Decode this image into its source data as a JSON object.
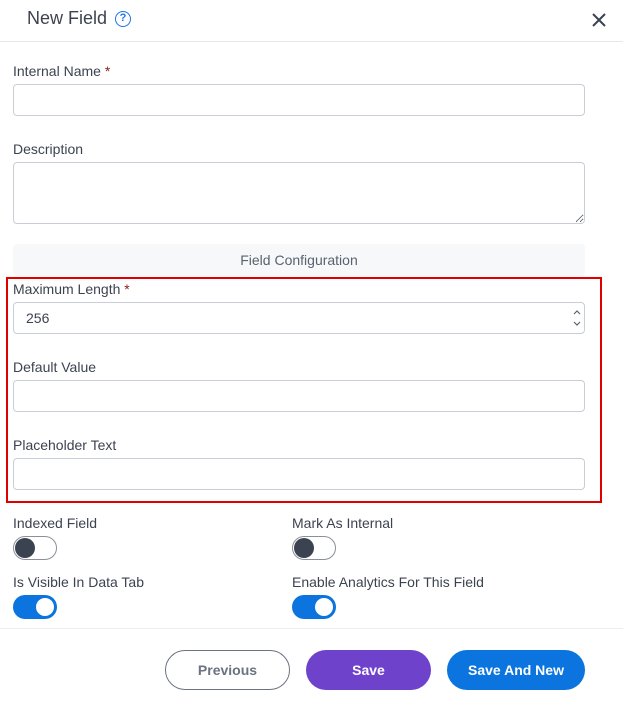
{
  "header": {
    "title": "New Field",
    "help_icon": "?",
    "close_icon": "close-icon"
  },
  "form": {
    "internal_name": {
      "label": "Internal Name",
      "required_mark": "*",
      "value": "",
      "placeholder": ""
    },
    "description": {
      "label": "Description",
      "value": "",
      "placeholder": ""
    },
    "section_title": "Field Configuration",
    "maximum_length": {
      "label": "Maximum Length",
      "required_mark": "*",
      "value": "256"
    },
    "default_value": {
      "label": "Default Value",
      "value": "",
      "placeholder": ""
    },
    "placeholder_text": {
      "label": "Placeholder Text",
      "value": "",
      "placeholder": ""
    }
  },
  "toggles": [
    {
      "label": "Indexed Field",
      "on": false
    },
    {
      "label": "Mark As Internal",
      "on": false
    },
    {
      "label": "Is Visible In Data Tab",
      "on": true
    },
    {
      "label": "Enable Analytics For This Field",
      "on": true
    }
  ],
  "footer": {
    "previous_label": "Previous",
    "save_label": "Save",
    "save_and_new_label": "Save And New"
  },
  "colors": {
    "highlight": "#e00000",
    "primary_blue": "#0b74de",
    "save_purple": "#6f42cc"
  }
}
